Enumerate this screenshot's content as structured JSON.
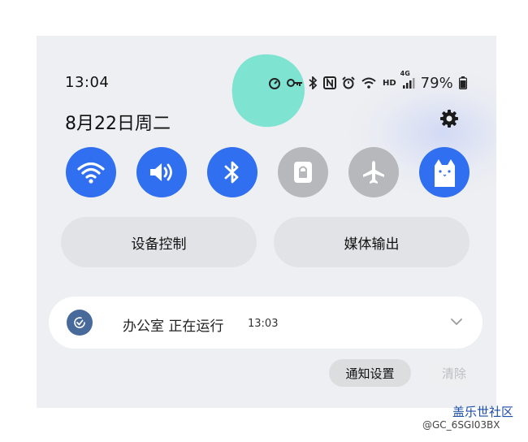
{
  "status_bar": {
    "time": "13:04",
    "icons": [
      "speedometer-icon",
      "vpn-key-icon",
      "bluetooth-icon",
      "nfc-icon",
      "alarm-icon",
      "wifi-icon",
      "hd-icon",
      "signal-4g-icon",
      "battery-icon"
    ],
    "hd_label": "HD",
    "net_label": "4G",
    "battery": "79%"
  },
  "date": "8月22日周二",
  "quick_tiles": [
    {
      "name": "wifi",
      "state": "on"
    },
    {
      "name": "sound",
      "state": "on"
    },
    {
      "name": "bluetooth",
      "state": "on"
    },
    {
      "name": "screen-lock",
      "state": "off"
    },
    {
      "name": "airplane-mode",
      "state": "off"
    },
    {
      "name": "cat-app",
      "state": "on"
    }
  ],
  "buttons": {
    "device_control": "设备控制",
    "media_output": "媒体输出"
  },
  "notification": {
    "title": "办公室 正在运行",
    "time": "13:03"
  },
  "actions": {
    "settings": "通知设置",
    "clear": "清除"
  },
  "watermark": {
    "line1": "盖乐世社区",
    "line2": "@GC_6SGI03BX"
  },
  "colors": {
    "accent": "#2f6ff0",
    "tile_off": "#b7b8bb",
    "panel": "#eeeff2",
    "highlight": "#7fe3d1"
  }
}
